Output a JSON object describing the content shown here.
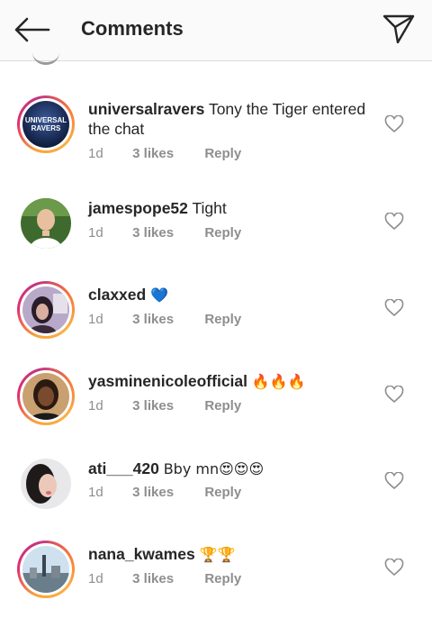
{
  "header": {
    "title": "Comments",
    "back_icon": "arrow-left-icon",
    "send_icon": "paper-plane-icon"
  },
  "comments": [
    {
      "username": "universalravers",
      "text": "Tony the Tiger entered the chat",
      "time": "1d",
      "likes": "3 likes",
      "reply": "Reply",
      "avatar_text_line1": "UNIVERSAL",
      "avatar_text_line2": "RAVERS"
    },
    {
      "username": "jamespope52",
      "text": "Tight",
      "time": "1d",
      "likes": "3 likes",
      "reply": "Reply"
    },
    {
      "username": "claxxed",
      "text": "💙",
      "time": "1d",
      "likes": "3 likes",
      "reply": "Reply"
    },
    {
      "username": "yasminenicoleofficial",
      "text": "🔥🔥🔥",
      "time": "1d",
      "likes": "3 likes",
      "reply": "Reply"
    },
    {
      "username": "ati___420",
      "text": "Bby mn😍😍😍",
      "time": "1d",
      "likes": "3 likes",
      "reply": "Reply"
    },
    {
      "username": "nana_kwames",
      "text": "🏆🏆",
      "time": "1d",
      "likes": "3 likes",
      "reply": "Reply"
    }
  ],
  "colors": {
    "text": "#262626",
    "meta": "#8e8e8e",
    "story_ring": "#e1306c",
    "heart_outline": "#8e8e8e",
    "heart_blue": "#3b8fe8"
  }
}
